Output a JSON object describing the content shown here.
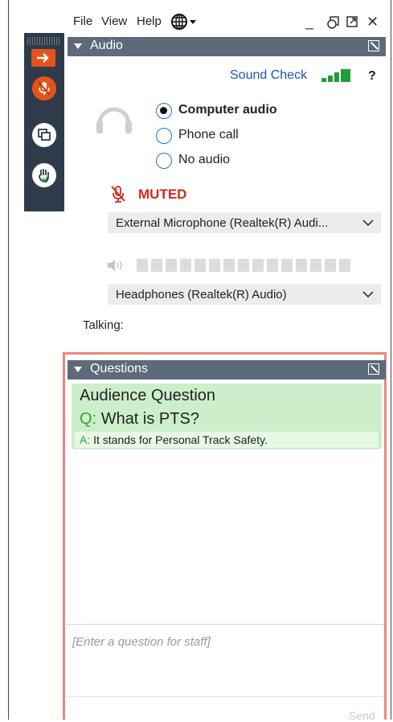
{
  "menubar": {
    "file": "File",
    "view": "View",
    "help": "Help",
    "minimize": "_",
    "close": "✕"
  },
  "strip": {
    "arrow_color": "#e5531b",
    "mic_color": "#e5531b"
  },
  "audio": {
    "header": "Audio",
    "sound_check": "Sound Check",
    "help_mark": "?",
    "options": [
      "Computer audio",
      "Phone call",
      "No audio"
    ],
    "selected_option": "Computer audio",
    "muted_label": "MUTED",
    "microphone": "External Microphone (Realtek(R) Audi...",
    "speaker": "Headphones (Realtek(R) Audio)",
    "talking_label": "Talking:"
  },
  "questions": {
    "header": "Questions",
    "item": {
      "title": "Audience Question",
      "q_prefix": "Q:",
      "question": "What is PTS?",
      "a_prefix": "A:",
      "answer": "It stands for Personal Track Safety."
    },
    "input_placeholder": "[Enter a question for staff]",
    "send_label": "Send"
  },
  "colors": {
    "accent": "#1a56b8",
    "muted": "#d02a1c",
    "highlight_border": "#ee8580",
    "qa_bg": "#cdeeca"
  }
}
